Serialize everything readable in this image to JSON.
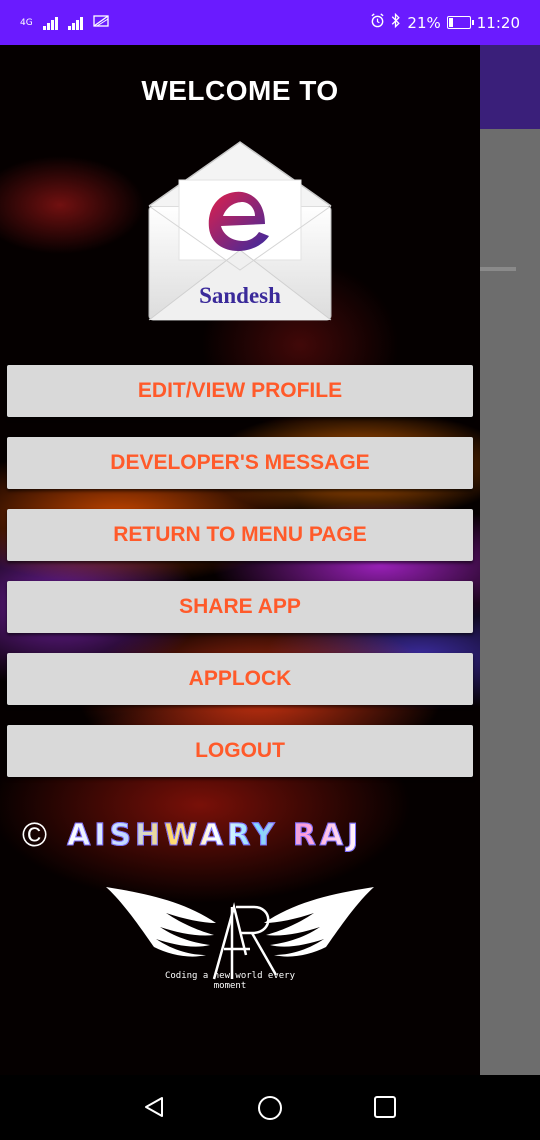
{
  "status_bar": {
    "network_1": "4G",
    "network_2": "",
    "battery_percent": "21%",
    "time": "11:20",
    "icons": [
      "signal-icon",
      "no-sim-icon",
      "alarm-icon",
      "bluetooth-icon",
      "battery-charging-icon"
    ]
  },
  "drawer": {
    "welcome": "WELCOME TO",
    "logo_text": "Sandesh",
    "menu": [
      {
        "label": "EDIT/VIEW PROFILE"
      },
      {
        "label": "DEVELOPER'S MESSAGE"
      },
      {
        "label": "RETURN TO MENU PAGE"
      },
      {
        "label": "SHARE APP"
      },
      {
        "label": "APPLOCK"
      },
      {
        "label": "LOGOUT"
      }
    ],
    "credit": {
      "copyright": "©",
      "name": "AISHWARY RAJ"
    },
    "emblem": {
      "monogram": "AR",
      "motto": "Coding a new world every moment"
    }
  },
  "nav_bar": {
    "icons": [
      "back-icon",
      "home-icon",
      "recents-icon"
    ]
  },
  "colors": {
    "status_bar": "#6a1bff",
    "menu_text": "#ff5a2a",
    "menu_bg": "#d9d9d9"
  }
}
